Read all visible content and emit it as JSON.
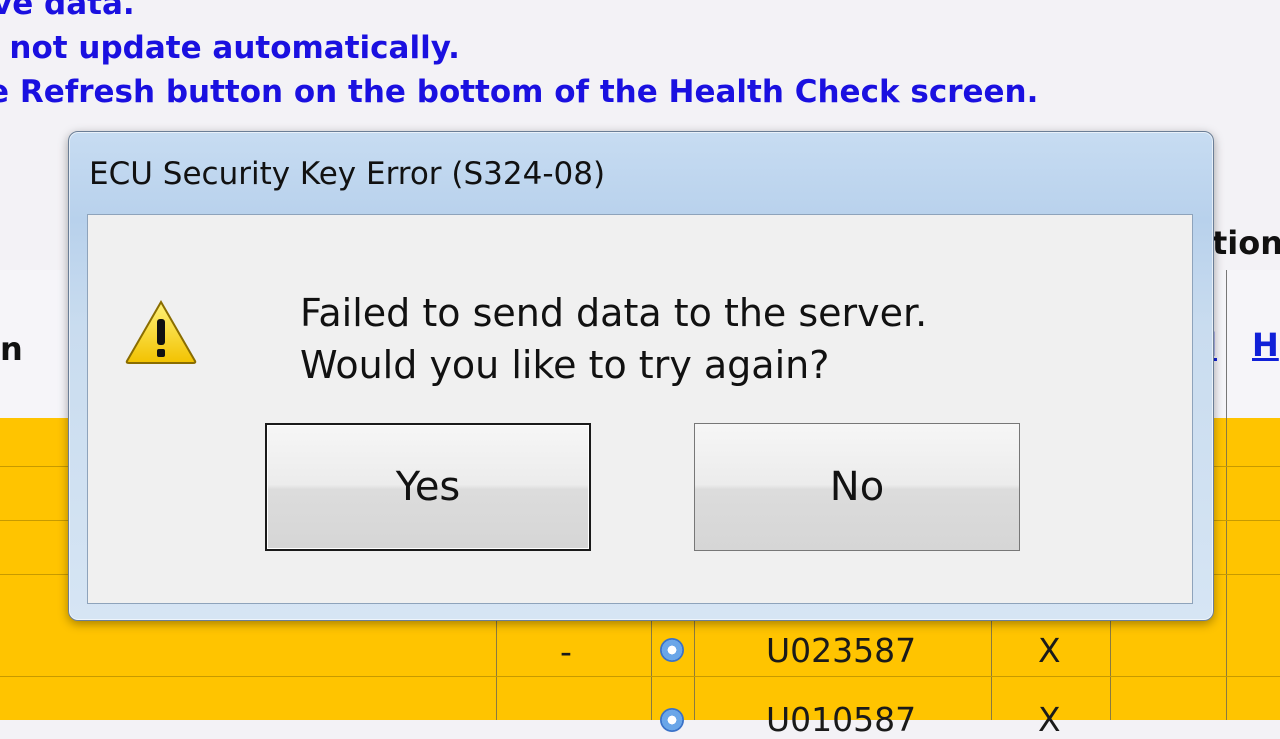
{
  "background": {
    "info_lines": [
      "ve data.",
      "l not update automatically.",
      "e Refresh button on the bottom of the Health Check screen."
    ],
    "table": {
      "header_right": "tion",
      "column_header_left": "n",
      "column_links": [
        "l",
        "H"
      ],
      "rows": [
        {
          "dash": "-",
          "code": "U023587",
          "mark": "X"
        },
        {
          "dash": "",
          "code": "U010587",
          "mark": "X"
        }
      ],
      "colors": {
        "highlight": "#ffc400",
        "link": "#1020d8",
        "info_text": "#1a10e0"
      }
    }
  },
  "dialog": {
    "title": "ECU Security Key Error (S324-08)",
    "icon": "warning-icon",
    "message_lines": [
      "Failed to send data to the server.",
      "Would you like to try again?"
    ],
    "buttons": {
      "yes": "Yes",
      "no": "No"
    }
  }
}
